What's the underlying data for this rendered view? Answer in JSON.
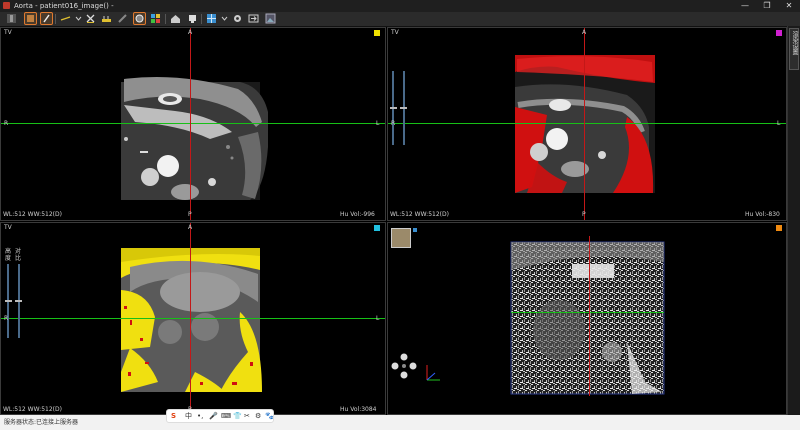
{
  "window": {
    "title": "Aorta - patient016_image() -",
    "minimize": "—",
    "restore": "❐",
    "close": "✕"
  },
  "toolbar": {
    "buttons": [
      "pan-tool",
      "window-level-tool",
      "measure-line",
      "delete-annotation",
      "ruler-measure",
      "brush-tool",
      "threshold-tool",
      "color-map",
      "house-tool",
      "flag-tool",
      "grid-layout",
      "settings",
      "export",
      "screenshot"
    ]
  },
  "viewports": {
    "top_left": {
      "orientation": "TV",
      "top": "A",
      "bottom": "P",
      "left": "R",
      "right": "L",
      "wl": "WL:512 WW:512(D)",
      "hu": "Hu Vol:-996",
      "corner_color": "#f0e000"
    },
    "top_right": {
      "orientation": "TV",
      "top": "A",
      "bottom": "P",
      "left": "R",
      "right": "L",
      "wl": "WL:512 WW:512(D)",
      "hu": "Hu Vol:-830",
      "corner_color": "#d020d0"
    },
    "bottom_left": {
      "orientation": "TV",
      "top": "A",
      "bottom": "P",
      "left": "R",
      "right": "L",
      "wl": "WL:512 WW:512(D)",
      "hu": "Hu Vol:3084",
      "corner_color": "#20c0e0",
      "slider_labels": [
        "高",
        "对"
      ],
      "slider_labels2": [
        "度",
        "比"
      ]
    },
    "bottom_right": {
      "corner_color": "#f08a10"
    }
  },
  "statusbar": {
    "label": "服务器状态:",
    "value": "已连接上服务器"
  },
  "ime": {
    "items": [
      "S",
      "中",
      "•,",
      "🎤",
      "⌨",
      "👕",
      "✂",
      "⚙",
      "🐾"
    ]
  },
  "sidepanel": {
    "tab_label": "渲染设置"
  },
  "colors": {
    "crosshair_h": "#17c017",
    "crosshair_v": "#c31818",
    "segmentation_red": "#d01010",
    "segmentation_yellow": "#f0e010"
  }
}
